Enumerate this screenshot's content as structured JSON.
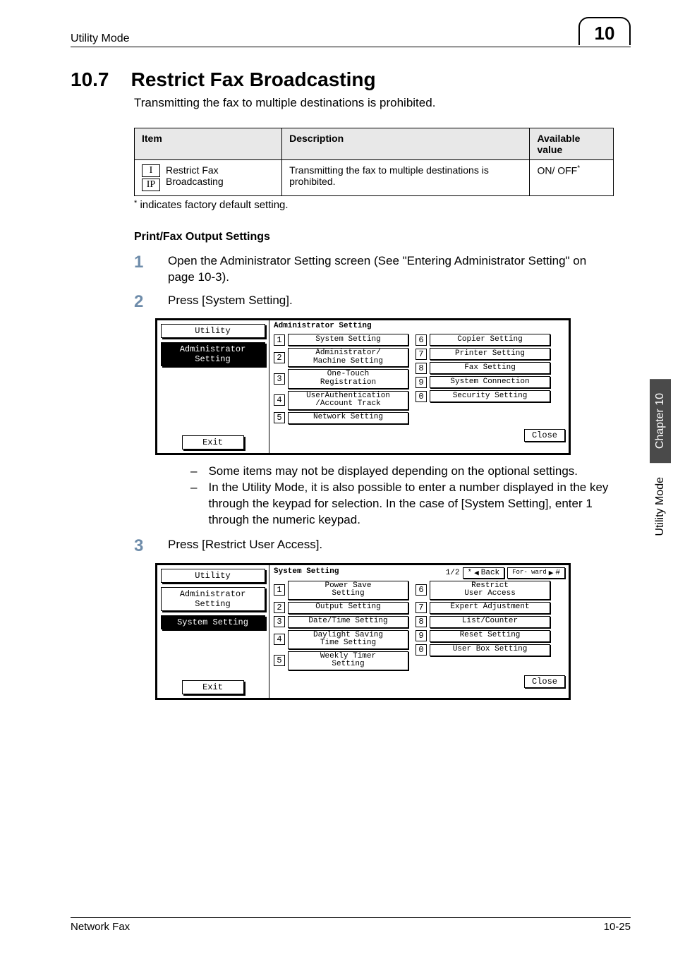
{
  "header": {
    "running_left": "Utility Mode",
    "chapter_badge": "10"
  },
  "side": {
    "dark": "Chapter 10",
    "light": "Utility Mode"
  },
  "section": {
    "number": "10.7",
    "title": "Restrict Fax Broadcasting",
    "intro": "Transmitting the fax to multiple destinations is prohibited."
  },
  "table": {
    "headers": {
      "item": "Item",
      "desc": "Description",
      "avail": "Available value"
    },
    "row": {
      "tags": [
        "I",
        "IP"
      ],
      "name": "Restrict Fax Broadcasting",
      "desc": "Transmitting the fax to multiple destinations is prohibited.",
      "value": "ON/ OFF",
      "star": "*"
    }
  },
  "footnote": {
    "star": "*",
    "text": " indicates factory default setting."
  },
  "subhead": "Print/Fax Output Settings",
  "steps": {
    "s1": "Open the Administrator Setting screen (See \"Entering Administrator Setting\" on page 10-3).",
    "s2": "Press [System Setting].",
    "s3": "Press [Restrict User Access]."
  },
  "lcd1": {
    "heading": "Administrator\nSetting",
    "left_tabs": [
      "Utility",
      "Administrator\nSetting"
    ],
    "exit": "Exit",
    "close": "Close",
    "left_col": [
      {
        "n": "1",
        "t": "System Setting"
      },
      {
        "n": "2",
        "t": "Administrator/\nMachine Setting"
      },
      {
        "n": "3",
        "t": "One-Touch\nRegistration"
      },
      {
        "n": "4",
        "t": "UserAuthentication\n/Account Track"
      },
      {
        "n": "5",
        "t": "Network Setting"
      }
    ],
    "right_col": [
      {
        "n": "6",
        "t": "Copier Setting"
      },
      {
        "n": "7",
        "t": "Printer Setting"
      },
      {
        "n": "8",
        "t": "Fax Setting"
      },
      {
        "n": "9",
        "t": "System Connection"
      },
      {
        "n": "0",
        "t": "Security Setting"
      }
    ]
  },
  "bullets": {
    "b1": "Some items may not be displayed depending on the optional settings.",
    "b2": "In the Utility Mode, it is also possible to enter a number displayed in the key through the keypad for selection. In the case of [System Setting], enter 1 through the numeric keypad."
  },
  "lcd2": {
    "heading": "System Setting",
    "page_indicator": "1/2",
    "back": "Back",
    "forward": "For-\nward",
    "star": "*",
    "hash": "#",
    "left_tabs": [
      "Utility",
      "Administrator\nSetting",
      "System Setting"
    ],
    "exit": "Exit",
    "close": "Close",
    "left_col": [
      {
        "n": "1",
        "t": "Power Save\nSetting"
      },
      {
        "n": "2",
        "t": "Output Setting"
      },
      {
        "n": "3",
        "t": "Date/Time Setting"
      },
      {
        "n": "4",
        "t": "Daylight Saving\nTime Setting"
      },
      {
        "n": "5",
        "t": "Weekly Timer\nSetting"
      }
    ],
    "right_col": [
      {
        "n": "6",
        "t": "Restrict\nUser Access"
      },
      {
        "n": "7",
        "t": "Expert Adjustment"
      },
      {
        "n": "8",
        "t": "List/Counter"
      },
      {
        "n": "9",
        "t": "Reset Setting"
      },
      {
        "n": "0",
        "t": "User Box Setting"
      }
    ]
  },
  "footer": {
    "left": "Network Fax",
    "right": "10-25"
  }
}
